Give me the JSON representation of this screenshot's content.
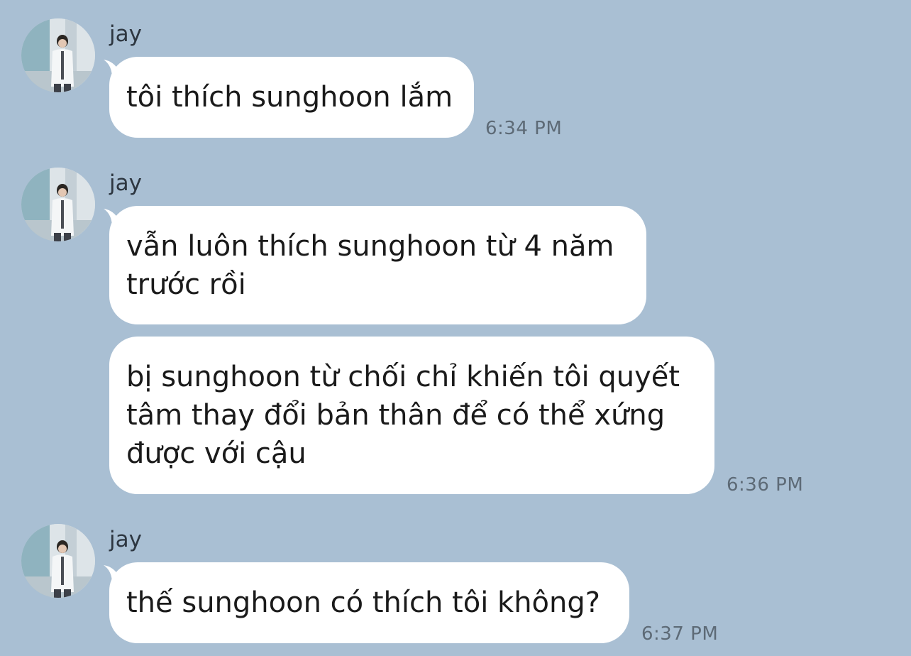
{
  "messages": [
    {
      "sender": "jay",
      "avatar_icon": "profile-photo-icon",
      "bubbles": [
        "tôi thích sunghoon lắm"
      ],
      "time": "6:34 PM"
    },
    {
      "sender": "jay",
      "avatar_icon": "profile-photo-icon",
      "bubbles": [
        "vẫn luôn thích sunghoon từ 4 năm\ntrước rồi",
        "bị sunghoon từ chối chỉ khiến tôi quyết\ntâm thay đổi bản thân để có thể xứng\nđược với cậu"
      ],
      "time": "6:36 PM"
    },
    {
      "sender": "jay",
      "avatar_icon": "profile-photo-icon",
      "bubbles": [
        "thế sunghoon có thích tôi không?"
      ],
      "time": "6:37 PM"
    }
  ],
  "colors": {
    "background": "#a9bfd3",
    "bubble": "#ffffff",
    "text": "#1a1a1a",
    "timestamp": "#5d6a76"
  }
}
